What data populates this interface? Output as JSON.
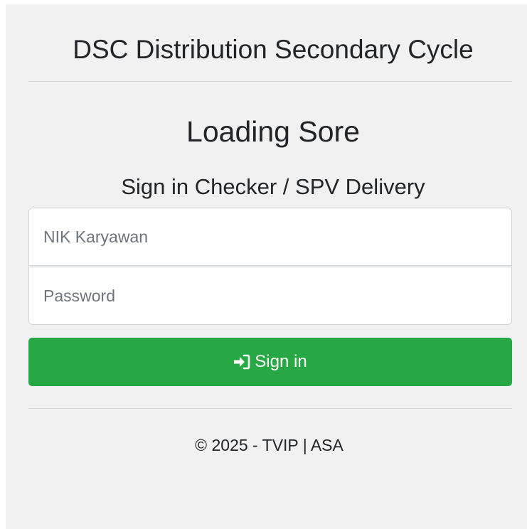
{
  "header": {
    "app_title": "DSC Distribution Secondary Cycle"
  },
  "page": {
    "heading": "Loading Sore",
    "subheading": "Sign in Checker / SPV Delivery"
  },
  "form": {
    "nik_placeholder": "NIK Karyawan",
    "nik_value": "",
    "password_placeholder": "Password",
    "password_value": "",
    "submit_label": "Sign in",
    "submit_icon": "sign-in-icon",
    "submit_color": "#28a745"
  },
  "footer": {
    "copyright": "© 2025 - TVIP | ASA"
  }
}
